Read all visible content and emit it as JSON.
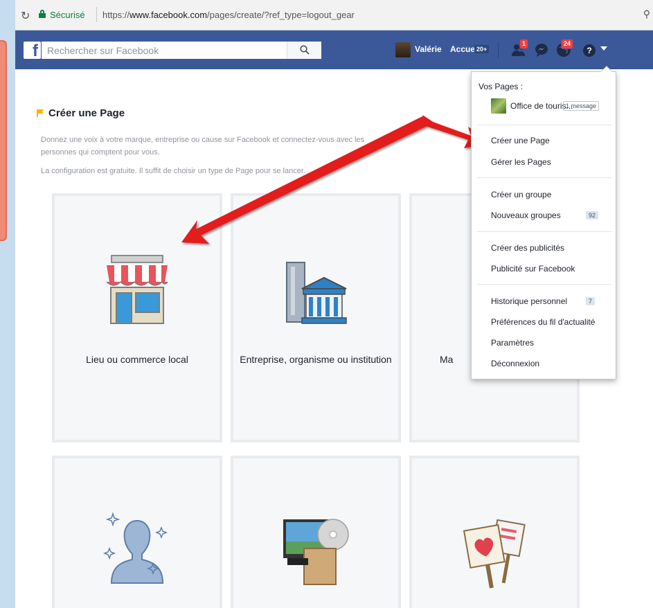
{
  "browser": {
    "secure_label": "Sécurisé",
    "url_prefix": "https://",
    "url_host": "www.facebook.com",
    "url_path": "/pages/create/?ref_type=logout_gear"
  },
  "fb_header": {
    "search_placeholder": "Rechercher sur Facebook",
    "user_name": "Valérie",
    "home_label": "Accueil",
    "home_badge": "20+",
    "friend_requests_count": "1",
    "notifications_count": "24",
    "help_label": "?"
  },
  "main": {
    "title": "Créer une Page",
    "description": "Donnez une voix à votre marque, entreprise ou cause sur Facebook et connectez-vous avec les personnes qui comptent pour vous.",
    "config_text": "La configuration est gratuite. Il suffit de choisir un type de Page pour se lancer.",
    "tiles": [
      {
        "label": "Lieu ou commerce local",
        "icon": "storefront-icon"
      },
      {
        "label": "Entreprise, organisme ou institution",
        "icon": "building-icon"
      },
      {
        "label": "Ma",
        "icon": "product-icon"
      },
      {
        "label": "",
        "icon": "public-figure-icon"
      },
      {
        "label": "",
        "icon": "entertainment-icon"
      },
      {
        "label": "",
        "icon": "cause-icon"
      }
    ]
  },
  "dropdown": {
    "header": "Vos Pages :",
    "page_name": "Office de touris...",
    "page_message_badge": "1 message",
    "items": {
      "create_page": "Créer une Page",
      "manage_pages": "Gérer les Pages",
      "create_group": "Créer un groupe",
      "new_groups": "Nouveaux groupes",
      "new_groups_count": "92",
      "create_ads": "Créer des publicités",
      "advertising": "Publicité sur Facebook",
      "activity_log": "Historique personnel",
      "news_feed_prefs": "Préférences du fil d'actualité",
      "settings": "Paramètres",
      "logout": "Déconnexion",
      "activity_log_count": "7"
    }
  },
  "colors": {
    "facebook_blue": "#3b5998",
    "annotation_arrow": "#e31b1b",
    "badge_red": "#fa3e3e"
  }
}
